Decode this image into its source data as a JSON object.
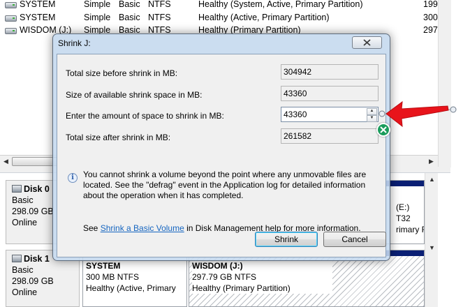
{
  "volumes": [
    {
      "name": "SYSTEM",
      "layout": "Simple",
      "type": "Basic",
      "fs": "NTFS",
      "status": "Healthy (System, Active, Primary Partition)",
      "capacity": "199"
    },
    {
      "name": "SYSTEM",
      "layout": "Simple",
      "type": "Basic",
      "fs": "NTFS",
      "status": "Healthy (Active, Primary Partition)",
      "capacity": "300"
    },
    {
      "name": "WISDOM (J:)",
      "layout": "Simple",
      "type": "Basic",
      "fs": "NTFS",
      "status": "Healthy (Primary Partition)",
      "capacity": "297"
    }
  ],
  "disks": [
    {
      "name": "Disk 0",
      "type": "Basic",
      "size": "298.09 GB",
      "state": "Online",
      "partition_fragments": [
        "(E:)",
        "T32",
        "rimary F"
      ]
    },
    {
      "name": "Disk 1",
      "type": "Basic",
      "size": "298.09 GB",
      "state": "Online",
      "partitions": [
        {
          "title": "SYSTEM",
          "size": "300 MB NTFS",
          "status": "Healthy (Active, Primary"
        },
        {
          "title": "WISDOM  (J:)",
          "size": "297.79 GB NTFS",
          "status": "Healthy (Primary Partition)"
        }
      ]
    }
  ],
  "dialog": {
    "title": "Shrink J:",
    "fields": {
      "total_before": {
        "label": "Total size before shrink in MB:",
        "value": "304942"
      },
      "available": {
        "label": "Size of available shrink space in MB:",
        "value": "43360"
      },
      "amount": {
        "label": "Enter the amount of space to shrink in MB:",
        "value": "43360"
      },
      "total_after": {
        "label": "Total size after shrink in MB:",
        "value": "261582"
      }
    },
    "info_text": "You cannot shrink a volume beyond the point where any unmovable files are located. See the \"defrag\" event in the Application log for detailed information about the operation when it has completed.",
    "see_prefix": "See ",
    "see_link": "Shrink a Basic Volume",
    "see_suffix": " in Disk Management help for more information.",
    "shrink_label": "Shrink",
    "cancel_label": "Cancel"
  },
  "colors": {
    "partition_bar": "#0a1f74",
    "annotation_arrow": "#e8141b",
    "delete_badge": "#1a9c5c",
    "link": "#1565c0"
  },
  "icons": [
    "drive-icon",
    "disk-icon",
    "close-icon",
    "info-icon",
    "spin-up-icon",
    "spin-down-icon",
    "arrow-annotation-icon",
    "delete-annotation-icon"
  ]
}
